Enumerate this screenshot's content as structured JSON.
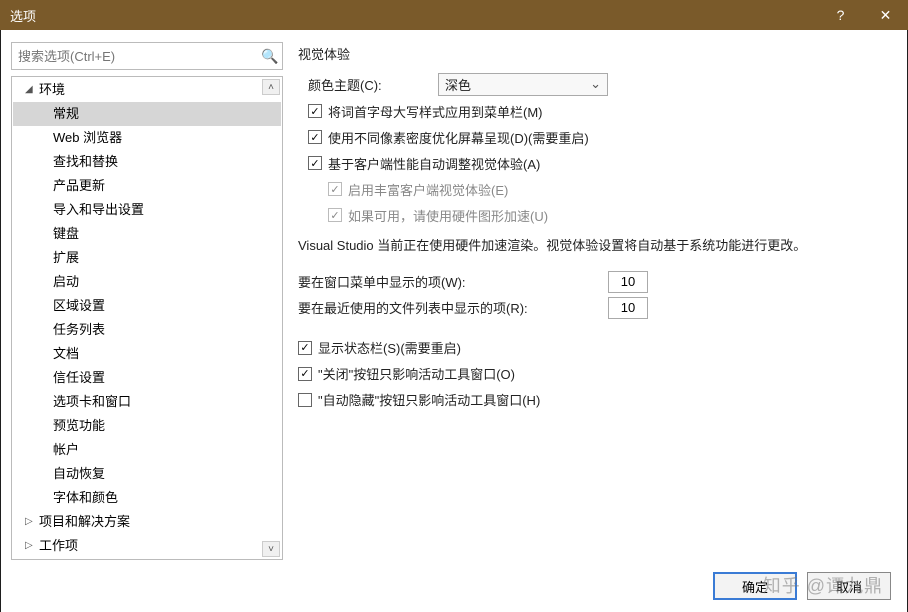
{
  "window": {
    "title": "选项",
    "help_icon": "?",
    "close_icon": "✕"
  },
  "search": {
    "placeholder": "搜索选项(Ctrl+E)"
  },
  "tree": {
    "top": [
      {
        "label": "环境",
        "expanded": true
      },
      {
        "label": "项目和解决方案",
        "expanded": false
      },
      {
        "label": "工作项",
        "expanded": false
      }
    ],
    "env_children": [
      "常规",
      "Web 浏览器",
      "查找和替换",
      "产品更新",
      "导入和导出设置",
      "键盘",
      "扩展",
      "启动",
      "区域设置",
      "任务列表",
      "文档",
      "信任设置",
      "选项卡和窗口",
      "预览功能",
      "帐户",
      "自动恢复",
      "字体和颜色"
    ],
    "selected": "常规"
  },
  "right": {
    "section_title": "视觉体验",
    "theme_label": "颜色主题(C):",
    "theme_value": "深色",
    "cb_titlecase": "将词首字母大写样式应用到菜单栏(M)",
    "cb_dpi": "使用不同像素密度优化屏幕呈现(D)(需要重启)",
    "cb_auto_visual": "基于客户端性能自动调整视觉体验(A)",
    "cb_rich_client": "启用丰富客户端视觉体验(E)",
    "cb_hw_accel": "如果可用，请使用硬件图形加速(U)",
    "desc": "Visual Studio 当前正在使用硬件加速渲染。视觉体验设置将自动基于系统功能进行更改。",
    "window_menu_label": "要在窗口菜单中显示的项(W):",
    "window_menu_value": "10",
    "recent_files_label": "要在最近使用的文件列表中显示的项(R):",
    "recent_files_value": "10",
    "cb_statusbar": "显示状态栏(S)(需要重启)",
    "cb_close_btn": "\"关闭\"按钮只影响活动工具窗口(O)",
    "cb_autohide": "\"自动隐藏\"按钮只影响活动工具窗口(H)"
  },
  "buttons": {
    "ok": "确定",
    "cancel": "取消"
  },
  "watermark": "知乎 @谭九鼎"
}
